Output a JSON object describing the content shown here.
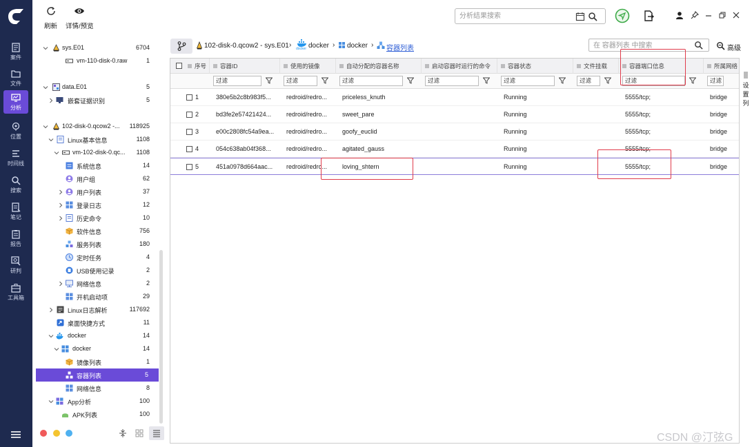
{
  "toolbar": {
    "refresh_label": "刷新",
    "preview_label": "详情/预览",
    "search_placeholder": "分析结果搜索"
  },
  "nav": {
    "items": [
      {
        "label": "案件",
        "icon": "case-icon"
      },
      {
        "label": "文件",
        "icon": "file-icon"
      },
      {
        "label": "分析",
        "icon": "analysis-icon",
        "active": true
      },
      {
        "label": "位置",
        "icon": "location-icon"
      },
      {
        "label": "时间线",
        "icon": "timeline-icon"
      },
      {
        "label": "搜索",
        "icon": "search-icon"
      },
      {
        "label": "笔记",
        "icon": "note-icon"
      },
      {
        "label": "报告",
        "icon": "report-icon"
      },
      {
        "label": "研判",
        "icon": "judge-icon"
      },
      {
        "label": "工具箱",
        "icon": "toolbox-icon"
      }
    ],
    "active_color": "#6a4bd8",
    "bg_color": "#1e2a4f"
  },
  "tree": {
    "items": [
      {
        "label": "sys.E01",
        "count": "6704"
      },
      {
        "label": "vm-110-disk-0.raw",
        "count": "1"
      },
      {
        "label": "data.E01",
        "count": "5"
      },
      {
        "label": "嵌套证据识别",
        "count": "5"
      },
      {
        "label": "102-disk-0.qcow2 -...",
        "count": "118925"
      },
      {
        "label": "Linux基本信息",
        "count": "1108"
      },
      {
        "label": "vm-102-disk-0.qc...",
        "count": "1108"
      },
      {
        "label": "系统信息",
        "count": "14"
      },
      {
        "label": "用户组",
        "count": "62"
      },
      {
        "label": "用户列表",
        "count": "37"
      },
      {
        "label": "登录日志",
        "count": "12"
      },
      {
        "label": "历史命令",
        "count": "10"
      },
      {
        "label": "软件信息",
        "count": "756"
      },
      {
        "label": "服务列表",
        "count": "180"
      },
      {
        "label": "定时任务",
        "count": "4"
      },
      {
        "label": "USB使用记录",
        "count": "2"
      },
      {
        "label": "网络信息",
        "count": "2"
      },
      {
        "label": "开机启动项",
        "count": "29"
      },
      {
        "label": "Linux日志解析",
        "count": "117692"
      },
      {
        "label": "桌面快捷方式",
        "count": "11"
      },
      {
        "label": "docker",
        "count": "14"
      },
      {
        "label": "docker",
        "count": "14"
      },
      {
        "label": "镜像列表",
        "count": "1"
      },
      {
        "label": "容器列表",
        "count": "5"
      },
      {
        "label": "网络信息",
        "count": "8"
      },
      {
        "label": "App分析",
        "count": "100"
      },
      {
        "label": "APK列表",
        "count": "100"
      }
    ]
  },
  "breadcrumb": {
    "items": [
      "102-disk-0.qcow2 - sys.E01",
      "docker",
      "docker",
      "容器列表"
    ],
    "docker_logo_text": "docker"
  },
  "list_search": {
    "placeholder": "在 容器列表 中搜索"
  },
  "advanced_label": "高级",
  "settings_label": [
    "设",
    "置",
    "列"
  ],
  "table": {
    "columns": [
      "序号",
      "容器ID",
      "使用的镜像",
      "自动分配的容器名称",
      "启动容器时运行的命令",
      "容器状态",
      "文件挂载",
      "容器端口信息",
      "所属网络"
    ],
    "filter_placeholder": "过滤",
    "rows": [
      {
        "index": "1",
        "id": "380e5b2c8b983f5...",
        "image": "redroid/redro...",
        "name": "priceless_knuth",
        "command": "",
        "status": "Running",
        "mount": "",
        "port": "5555/tcp;",
        "network": "bridge"
      },
      {
        "index": "2",
        "id": "bd3fe2e57421424...",
        "image": "redroid/redro...",
        "name": "sweet_pare",
        "command": "",
        "status": "Running",
        "mount": "",
        "port": "5555/tcp;",
        "network": "bridge"
      },
      {
        "index": "3",
        "id": "e00c2808fc54a9ea...",
        "image": "redroid/redro...",
        "name": "goofy_euclid",
        "command": "",
        "status": "Running",
        "mount": "",
        "port": "5555/tcp;",
        "network": "bridge"
      },
      {
        "index": "4",
        "id": "054c638ab04f368...",
        "image": "redroid/redro...",
        "name": "agitated_gauss",
        "command": "",
        "status": "Running",
        "mount": "",
        "port": "5555/tcp;",
        "network": "bridge"
      },
      {
        "index": "5",
        "id": "451a0978d664aac...",
        "image": "redroid/redro...",
        "name": "loving_shtern",
        "command": "",
        "status": "Running",
        "mount": "",
        "port": "5555/tcp;",
        "network": "bridge"
      }
    ]
  },
  "watermark": "CSDN @汀弦G",
  "colors": {
    "highlight": "#e03a4a",
    "accent": "#6a4bd8",
    "link": "#2f5fd6"
  }
}
